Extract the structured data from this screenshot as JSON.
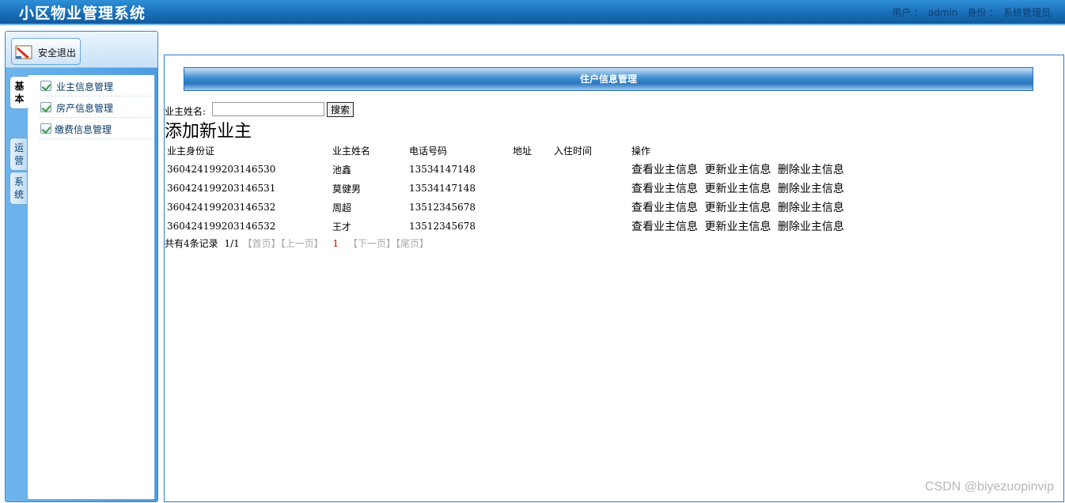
{
  "header": {
    "app_title": "小区物业管理系统",
    "user_label": "用户 ：",
    "user_name": "admin",
    "role_label": "身份 ：",
    "role_name": "系统管理员"
  },
  "sidebar": {
    "logout_label": "安全退出",
    "tabs": [
      {
        "label": "基本",
        "active": true
      },
      {
        "label": "运营",
        "active": false
      },
      {
        "label": "系统",
        "active": false
      }
    ],
    "items": [
      {
        "label": "业主信息管理"
      },
      {
        "label": "房产信息管理"
      },
      {
        "label": "缴费信息管理"
      }
    ]
  },
  "main": {
    "panel_title": "住户信息管理",
    "search": {
      "label": "业主姓名:",
      "value": "",
      "button": "搜索"
    },
    "add_link": "添加新业主",
    "table": {
      "columns": [
        "业主身份证",
        "业主姓名",
        "电话号码",
        "地址",
        "入住时间",
        "操作"
      ],
      "rows": [
        {
          "id": "360424199203146530",
          "name": "池鑫",
          "phone": "13534147148",
          "address": "",
          "date": ""
        },
        {
          "id": "360424199203146531",
          "name": "莫健男",
          "phone": "13534147148",
          "address": "",
          "date": ""
        },
        {
          "id": "360424199203146532",
          "name": "周超",
          "phone": "13512345678",
          "address": "",
          "date": ""
        },
        {
          "id": "360424199203146532",
          "name": "王才",
          "phone": "13512345678",
          "address": "",
          "date": ""
        }
      ],
      "actions": {
        "view": "查看业主信息",
        "update": "更新业主信息",
        "delete": "删除业主信息"
      }
    },
    "pager": {
      "total": "共有4条记录",
      "page": "1/1",
      "first": "【首页】",
      "prev": "【上一页】",
      "current": "1",
      "next": "【下一页】",
      "last": "【尾页】"
    }
  },
  "watermark": "CSDN @biyezuopinvip",
  "colors": {
    "header_blue": "#1a6fb8",
    "panel_blue": "#2c77bf",
    "pager_current": "#cc0000"
  }
}
